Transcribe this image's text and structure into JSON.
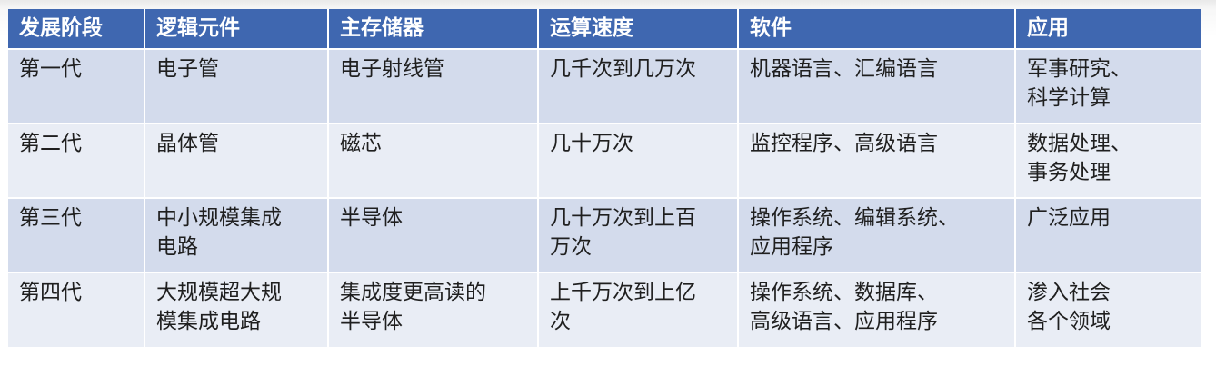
{
  "table": {
    "headers": [
      "发展阶段",
      "逻辑元件",
      "主存储器",
      "运算速度",
      "软件",
      "应用"
    ],
    "rows": [
      {
        "stage": [
          "第一代"
        ],
        "logic": [
          "电子管"
        ],
        "memory": [
          "电子射线管"
        ],
        "speed": [
          "几千次到几万次"
        ],
        "software": [
          "机器语言、汇编语言"
        ],
        "application": [
          "军事研究、",
          "科学计算"
        ]
      },
      {
        "stage": [
          "第二代"
        ],
        "logic": [
          "晶体管"
        ],
        "memory": [
          "磁芯"
        ],
        "speed": [
          "几十万次"
        ],
        "software": [
          "监控程序、高级语言"
        ],
        "application": [
          "数据处理、",
          "事务处理"
        ]
      },
      {
        "stage": [
          "第三代"
        ],
        "logic": [
          "中小规模集成",
          "电路"
        ],
        "memory": [
          "半导体"
        ],
        "speed": [
          "几十万次到上百",
          "万次"
        ],
        "software": [
          "操作系统、编辑系统、",
          "应用程序"
        ],
        "application": [
          "广泛应用"
        ]
      },
      {
        "stage": [
          "第四代"
        ],
        "logic": [
          "大规模超大规",
          "模集成电路"
        ],
        "memory": [
          "集成度更高读的",
          "半导体"
        ],
        "speed": [
          "上千万次到上亿",
          "次"
        ],
        "software": [
          "操作系统、数据库、",
          "高级语言、应用程序"
        ],
        "application": [
          "渗入社会",
          "各个领域"
        ]
      }
    ]
  }
}
